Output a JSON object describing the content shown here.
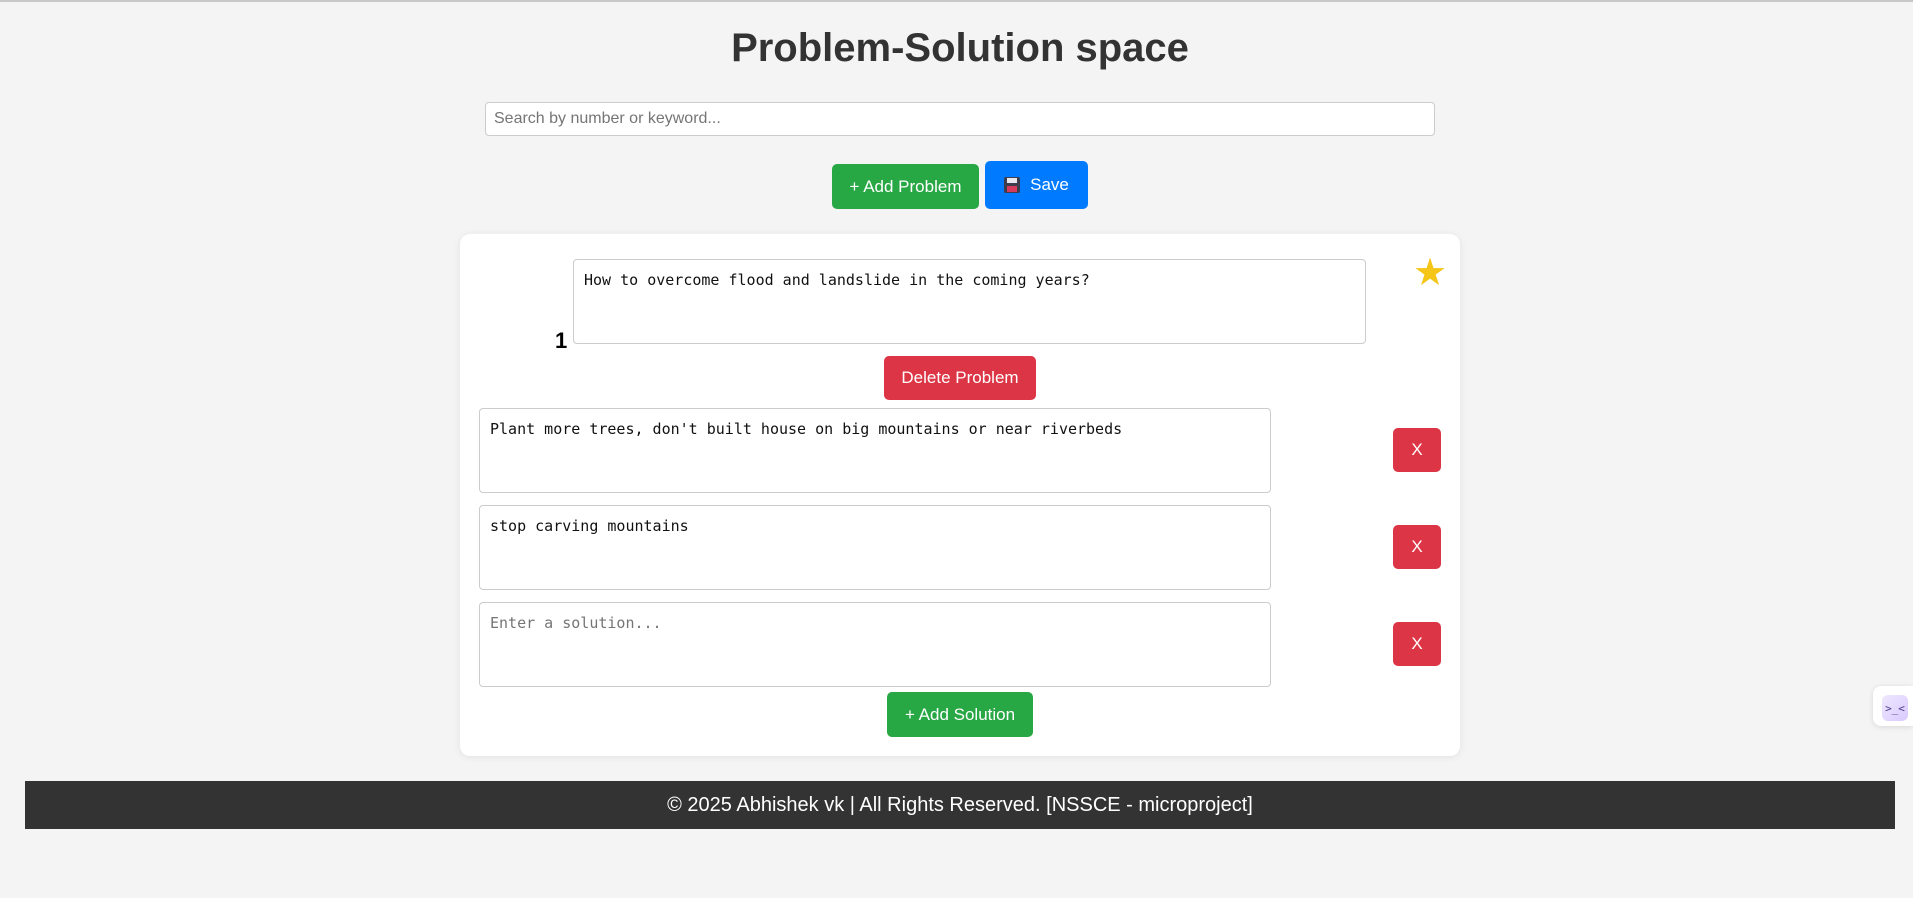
{
  "page": {
    "title": "Problem-Solution space"
  },
  "search": {
    "placeholder": "Search by number or keyword...",
    "value": ""
  },
  "toolbar": {
    "add_problem_label": "+ Add Problem",
    "save_label": "Save"
  },
  "problem": {
    "number": "1",
    "text": "How to overcome flood and landslide in the coming years?",
    "starred": true,
    "delete_label": "Delete Problem",
    "solutions": [
      {
        "value": "Plant more trees, don't built house on big mountains or near riverbeds",
        "remove_label": "X"
      },
      {
        "value": "stop carving mountains",
        "remove_label": "X"
      },
      {
        "value": "",
        "placeholder": "Enter a solution...",
        "remove_label": "X"
      }
    ],
    "add_solution_label": "+ Add Solution"
  },
  "footer": {
    "text": "© 2025 Abhishek vk | All Rights Reserved. [NSSCE - microproject]"
  },
  "widget": {
    "icon_text": ">_<"
  },
  "colors": {
    "green": "#28a745",
    "blue": "#007bff",
    "red": "#dc3545",
    "star": "#f5c518",
    "footer_bg": "#333333",
    "page_bg": "#f4f4f4"
  },
  "icons": {
    "star": "star-icon",
    "save": "floppy-disk-icon",
    "widget": "terminal-face-icon"
  }
}
